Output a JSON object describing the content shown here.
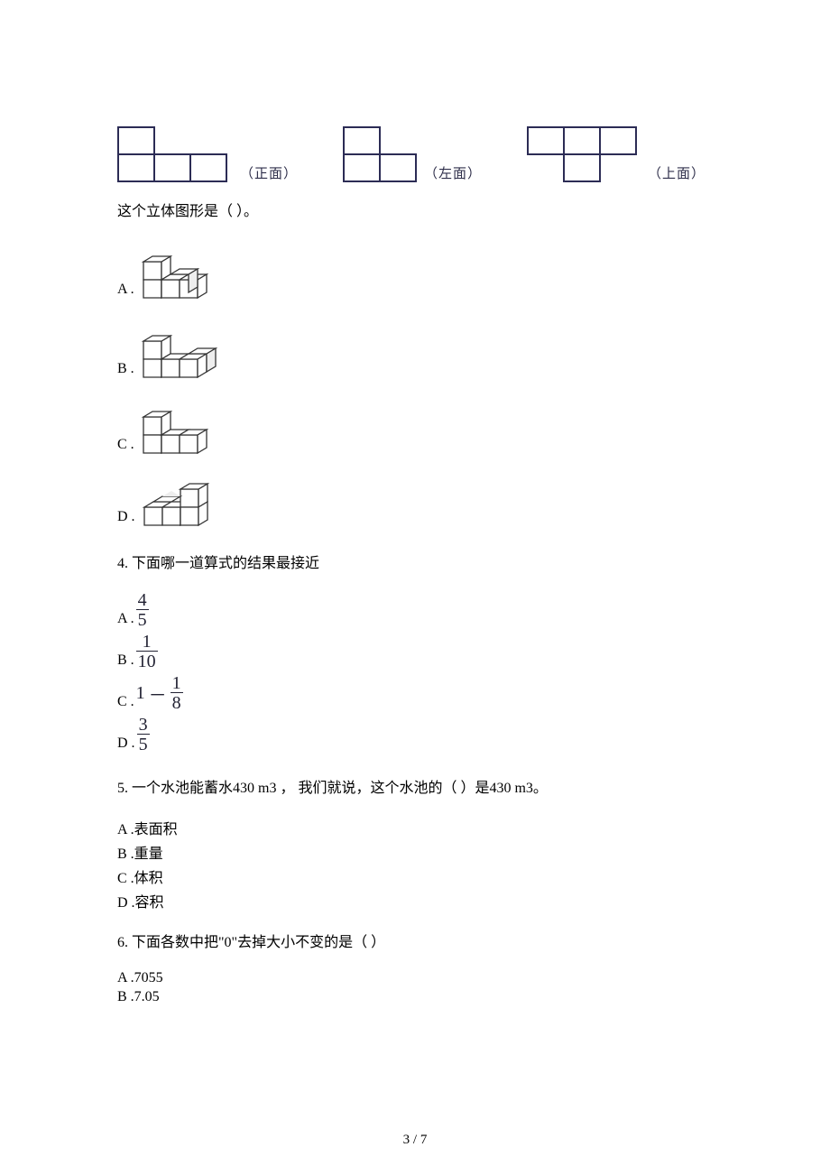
{
  "views": {
    "front_label": "（正面）",
    "left_label": "（左面）",
    "top_label": "（上面）"
  },
  "q3": {
    "stem": "这个立体图形是（  ）。",
    "A": "A .",
    "B": "B .",
    "C": "C .",
    "D": "D ."
  },
  "q4": {
    "stem": "4. 下面哪一道算式的结果最接近",
    "A_prefix": "A .",
    "A_num": "4",
    "A_den": "5",
    "B_prefix": "B .",
    "B_num": "1",
    "B_den": "10",
    "C_prefix": "C .",
    "C_one": "1",
    "C_minus": "－",
    "C_num": "1",
    "C_den": "8",
    "D_prefix": "D .",
    "D_num": "3",
    "D_den": "5"
  },
  "q5": {
    "stem": "5. 一个水池能蓄水430 m3 ，  我们就说，这个水池的（   ）是430 m3。",
    "A": "A .表面积",
    "B": "B .重量",
    "C": "C .体积",
    "D": "D .容积"
  },
  "q6": {
    "stem": "6. 下面各数中把\"0\"去掉大小不变的是（   ）",
    "A": "A .7055",
    "B": "B .7.05"
  },
  "page_number": "3 / 7"
}
